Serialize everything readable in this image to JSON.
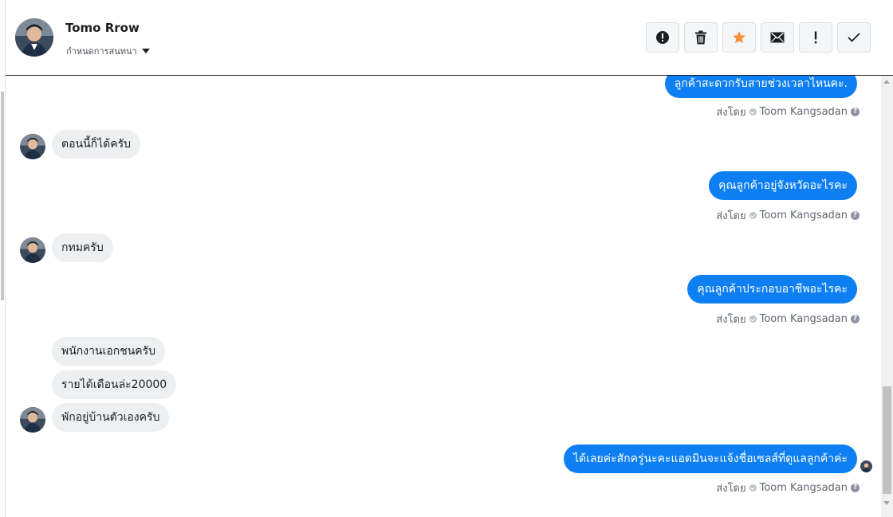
{
  "contact": {
    "name": "Tomo Rrow",
    "subtitle": "กำหนดการสนทนา"
  },
  "actions": [
    {
      "name": "report-icon"
    },
    {
      "name": "trash-icon"
    },
    {
      "name": "star-icon"
    },
    {
      "name": "envelope-icon"
    },
    {
      "name": "exclamation-icon"
    },
    {
      "name": "check-icon"
    }
  ],
  "colors": {
    "accent": "#0d7ff2",
    "star": "#f7923b",
    "incoming_bubble": "#eeeff1"
  },
  "messages": [
    {
      "dir": "out",
      "text": "ลูกค้าสะดวกรับสายช่วงเวลาไหนคะ."
    },
    {
      "dir": "in",
      "text": "ตอนนี้ก็ได้ครับ"
    },
    {
      "dir": "out",
      "text": "คุณลูกค้าอยู่จังหวัดอะไรคะ"
    },
    {
      "dir": "in",
      "text": "กทมครับ"
    },
    {
      "dir": "out",
      "text": "คุณลูกค้าประกอบอาชีพอะไรคะ"
    },
    {
      "dir": "in",
      "text": "พนักงานเอกชนครับ"
    },
    {
      "dir": "in",
      "text": "รายได้เดือนล่ะ20000"
    },
    {
      "dir": "in",
      "text": "พักอยู่บ้านตัวเองครับ"
    },
    {
      "dir": "out",
      "text": "ได้เลยค่ะสักครู่นะคะแอดมินจะแจ้งชื่อเซลส์ที่ดูแลลูกค้าค่ะ"
    }
  ],
  "sent_by": {
    "prefix": "ส่งโดย",
    "agent": "Toom Kangsadan"
  }
}
